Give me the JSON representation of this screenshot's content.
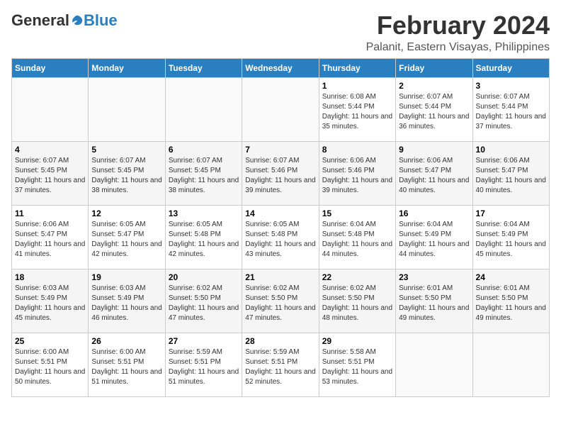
{
  "logo": {
    "general": "General",
    "blue": "Blue"
  },
  "header": {
    "month": "February 2024",
    "location": "Palanit, Eastern Visayas, Philippines"
  },
  "weekdays": [
    "Sunday",
    "Monday",
    "Tuesday",
    "Wednesday",
    "Thursday",
    "Friday",
    "Saturday"
  ],
  "weeks": [
    [
      {
        "day": "",
        "sunrise": "",
        "sunset": "",
        "daylight": "",
        "empty": true
      },
      {
        "day": "",
        "sunrise": "",
        "sunset": "",
        "daylight": "",
        "empty": true
      },
      {
        "day": "",
        "sunrise": "",
        "sunset": "",
        "daylight": "",
        "empty": true
      },
      {
        "day": "",
        "sunrise": "",
        "sunset": "",
        "daylight": "",
        "empty": true
      },
      {
        "day": "1",
        "sunrise": "Sunrise: 6:08 AM",
        "sunset": "Sunset: 5:44 PM",
        "daylight": "Daylight: 11 hours and 35 minutes.",
        "empty": false
      },
      {
        "day": "2",
        "sunrise": "Sunrise: 6:07 AM",
        "sunset": "Sunset: 5:44 PM",
        "daylight": "Daylight: 11 hours and 36 minutes.",
        "empty": false
      },
      {
        "day": "3",
        "sunrise": "Sunrise: 6:07 AM",
        "sunset": "Sunset: 5:44 PM",
        "daylight": "Daylight: 11 hours and 37 minutes.",
        "empty": false
      }
    ],
    [
      {
        "day": "4",
        "sunrise": "Sunrise: 6:07 AM",
        "sunset": "Sunset: 5:45 PM",
        "daylight": "Daylight: 11 hours and 37 minutes.",
        "empty": false
      },
      {
        "day": "5",
        "sunrise": "Sunrise: 6:07 AM",
        "sunset": "Sunset: 5:45 PM",
        "daylight": "Daylight: 11 hours and 38 minutes.",
        "empty": false
      },
      {
        "day": "6",
        "sunrise": "Sunrise: 6:07 AM",
        "sunset": "Sunset: 5:45 PM",
        "daylight": "Daylight: 11 hours and 38 minutes.",
        "empty": false
      },
      {
        "day": "7",
        "sunrise": "Sunrise: 6:07 AM",
        "sunset": "Sunset: 5:46 PM",
        "daylight": "Daylight: 11 hours and 39 minutes.",
        "empty": false
      },
      {
        "day": "8",
        "sunrise": "Sunrise: 6:06 AM",
        "sunset": "Sunset: 5:46 PM",
        "daylight": "Daylight: 11 hours and 39 minutes.",
        "empty": false
      },
      {
        "day": "9",
        "sunrise": "Sunrise: 6:06 AM",
        "sunset": "Sunset: 5:47 PM",
        "daylight": "Daylight: 11 hours and 40 minutes.",
        "empty": false
      },
      {
        "day": "10",
        "sunrise": "Sunrise: 6:06 AM",
        "sunset": "Sunset: 5:47 PM",
        "daylight": "Daylight: 11 hours and 40 minutes.",
        "empty": false
      }
    ],
    [
      {
        "day": "11",
        "sunrise": "Sunrise: 6:06 AM",
        "sunset": "Sunset: 5:47 PM",
        "daylight": "Daylight: 11 hours and 41 minutes.",
        "empty": false
      },
      {
        "day": "12",
        "sunrise": "Sunrise: 6:05 AM",
        "sunset": "Sunset: 5:47 PM",
        "daylight": "Daylight: 11 hours and 42 minutes.",
        "empty": false
      },
      {
        "day": "13",
        "sunrise": "Sunrise: 6:05 AM",
        "sunset": "Sunset: 5:48 PM",
        "daylight": "Daylight: 11 hours and 42 minutes.",
        "empty": false
      },
      {
        "day": "14",
        "sunrise": "Sunrise: 6:05 AM",
        "sunset": "Sunset: 5:48 PM",
        "daylight": "Daylight: 11 hours and 43 minutes.",
        "empty": false
      },
      {
        "day": "15",
        "sunrise": "Sunrise: 6:04 AM",
        "sunset": "Sunset: 5:48 PM",
        "daylight": "Daylight: 11 hours and 44 minutes.",
        "empty": false
      },
      {
        "day": "16",
        "sunrise": "Sunrise: 6:04 AM",
        "sunset": "Sunset: 5:49 PM",
        "daylight": "Daylight: 11 hours and 44 minutes.",
        "empty": false
      },
      {
        "day": "17",
        "sunrise": "Sunrise: 6:04 AM",
        "sunset": "Sunset: 5:49 PM",
        "daylight": "Daylight: 11 hours and 45 minutes.",
        "empty": false
      }
    ],
    [
      {
        "day": "18",
        "sunrise": "Sunrise: 6:03 AM",
        "sunset": "Sunset: 5:49 PM",
        "daylight": "Daylight: 11 hours and 45 minutes.",
        "empty": false
      },
      {
        "day": "19",
        "sunrise": "Sunrise: 6:03 AM",
        "sunset": "Sunset: 5:49 PM",
        "daylight": "Daylight: 11 hours and 46 minutes.",
        "empty": false
      },
      {
        "day": "20",
        "sunrise": "Sunrise: 6:02 AM",
        "sunset": "Sunset: 5:50 PM",
        "daylight": "Daylight: 11 hours and 47 minutes.",
        "empty": false
      },
      {
        "day": "21",
        "sunrise": "Sunrise: 6:02 AM",
        "sunset": "Sunset: 5:50 PM",
        "daylight": "Daylight: 11 hours and 47 minutes.",
        "empty": false
      },
      {
        "day": "22",
        "sunrise": "Sunrise: 6:02 AM",
        "sunset": "Sunset: 5:50 PM",
        "daylight": "Daylight: 11 hours and 48 minutes.",
        "empty": false
      },
      {
        "day": "23",
        "sunrise": "Sunrise: 6:01 AM",
        "sunset": "Sunset: 5:50 PM",
        "daylight": "Daylight: 11 hours and 49 minutes.",
        "empty": false
      },
      {
        "day": "24",
        "sunrise": "Sunrise: 6:01 AM",
        "sunset": "Sunset: 5:50 PM",
        "daylight": "Daylight: 11 hours and 49 minutes.",
        "empty": false
      }
    ],
    [
      {
        "day": "25",
        "sunrise": "Sunrise: 6:00 AM",
        "sunset": "Sunset: 5:51 PM",
        "daylight": "Daylight: 11 hours and 50 minutes.",
        "empty": false
      },
      {
        "day": "26",
        "sunrise": "Sunrise: 6:00 AM",
        "sunset": "Sunset: 5:51 PM",
        "daylight": "Daylight: 11 hours and 51 minutes.",
        "empty": false
      },
      {
        "day": "27",
        "sunrise": "Sunrise: 5:59 AM",
        "sunset": "Sunset: 5:51 PM",
        "daylight": "Daylight: 11 hours and 51 minutes.",
        "empty": false
      },
      {
        "day": "28",
        "sunrise": "Sunrise: 5:59 AM",
        "sunset": "Sunset: 5:51 PM",
        "daylight": "Daylight: 11 hours and 52 minutes.",
        "empty": false
      },
      {
        "day": "29",
        "sunrise": "Sunrise: 5:58 AM",
        "sunset": "Sunset: 5:51 PM",
        "daylight": "Daylight: 11 hours and 53 minutes.",
        "empty": false
      },
      {
        "day": "",
        "sunrise": "",
        "sunset": "",
        "daylight": "",
        "empty": true
      },
      {
        "day": "",
        "sunrise": "",
        "sunset": "",
        "daylight": "",
        "empty": true
      }
    ]
  ]
}
